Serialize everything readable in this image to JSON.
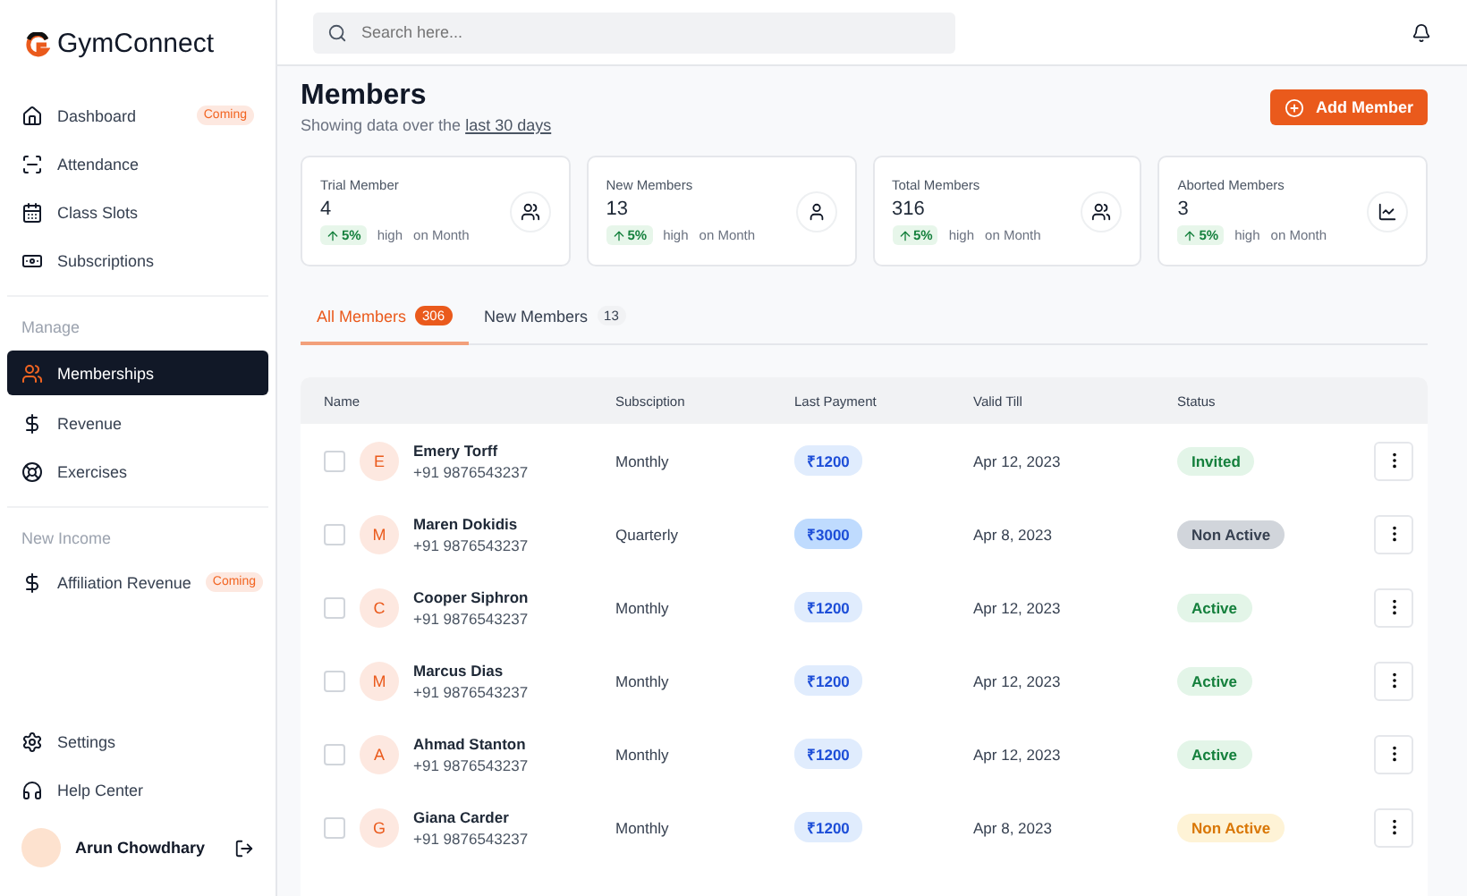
{
  "sidebar": {
    "logo": "GymConnect",
    "sections": [
      {
        "items": [
          {
            "label": "Dashboard",
            "badge": "Coming",
            "selected": false
          },
          {
            "label": "Attendance",
            "selected": false
          },
          {
            "label": "Class Slots",
            "selected": false
          },
          {
            "label": "Subscriptions",
            "selected": false
          }
        ]
      },
      {
        "heading": "Manage",
        "items": [
          {
            "label": "Memberships",
            "selected": true
          },
          {
            "label": "Revenue",
            "selected": false
          },
          {
            "label": "Exercises",
            "selected": false
          }
        ]
      },
      {
        "heading": "New Income",
        "items": [
          {
            "label": "Affiliation Revenue",
            "badge": "Coming",
            "selected": false
          }
        ]
      }
    ],
    "footer_items": [
      {
        "label": "Settings"
      },
      {
        "label": "Help Center"
      }
    ],
    "user": {
      "name": "Arun Chowdhary"
    }
  },
  "search": {
    "placeholder": "Search here..."
  },
  "header": {
    "title": "Members",
    "subtitle": "Showing data over the",
    "subtitle_link": "last 30 days",
    "button": "Add Member"
  },
  "stats": [
    {
      "label": "Trial Member",
      "value": "4",
      "change": "5%",
      "trend": "high",
      "period": "on Month"
    },
    {
      "label": "New Members",
      "value": "13",
      "change": "5%",
      "trend": "high",
      "period": "on Month"
    },
    {
      "label": "Total Members",
      "value": "316",
      "change": "5%",
      "trend": "high",
      "period": "on Month"
    },
    {
      "label": "Aborted Members",
      "value": "3",
      "change": "5%",
      "trend": "high",
      "period": "on Month"
    }
  ],
  "tabs": [
    {
      "label": "All  Members",
      "count": "306",
      "selected": true
    },
    {
      "label": "New Members",
      "count": "13",
      "selected": false
    }
  ],
  "table": {
    "columns": [
      "Name",
      "Subsciption",
      "Last Payment",
      "Valid Till",
      "Status"
    ],
    "rows": [
      {
        "initial": "E",
        "name": "Emery Torff",
        "phone": "+91 9876543237",
        "subscription": "Monthly",
        "payment": "₹1200",
        "payment_highlighted": false,
        "valid_till": "Apr 12, 2023",
        "status": "Invited",
        "kind": "invited",
        "checked": false
      },
      {
        "initial": "M",
        "name": "Maren Dokidis",
        "phone": "+91 9876543237",
        "subscription": "Quarterly",
        "payment": "₹3000",
        "payment_highlighted": true,
        "valid_till": "Apr 8, 2023",
        "status": "Non Active",
        "kind": "inactive",
        "checked": false
      },
      {
        "initial": "C",
        "name": "Cooper Siphron",
        "phone": "+91 9876543237",
        "subscription": "Monthly",
        "payment": "₹1200",
        "payment_highlighted": false,
        "valid_till": "Apr 12, 2023",
        "status": "Active",
        "kind": "active",
        "checked": false
      },
      {
        "initial": "M",
        "name": "Marcus Dias",
        "phone": "+91 9876543237",
        "subscription": "Monthly",
        "payment": "₹1200",
        "payment_highlighted": false,
        "valid_till": "Apr 12, 2023",
        "status": "Active",
        "kind": "active",
        "checked": false
      },
      {
        "initial": "A",
        "name": "Ahmad Stanton",
        "phone": "+91 9876543237",
        "subscription": "Monthly",
        "payment": "₹1200",
        "payment_highlighted": false,
        "valid_till": "Apr 12, 2023",
        "status": "Active",
        "kind": "active",
        "checked": false
      },
      {
        "initial": "G",
        "name": "Giana Carder",
        "phone": "+91 9876543237",
        "subscription": "Monthly",
        "payment": "₹1200",
        "payment_highlighted": false,
        "valid_till": "Apr 8, 2023",
        "status": "Non Active",
        "kind": "pending",
        "checked": false
      }
    ]
  }
}
